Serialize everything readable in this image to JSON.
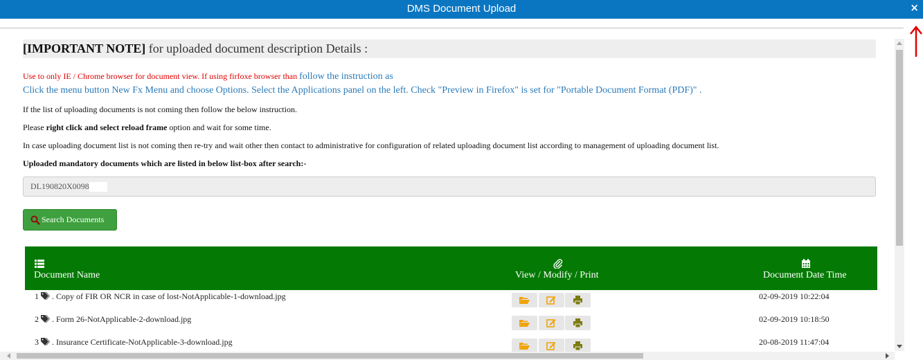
{
  "window": {
    "title": "DMS Document Upload",
    "close_label": "×"
  },
  "note": {
    "title_bold": "[IMPORTANT NOTE]",
    "title_rest": " for uploaded document description Details :",
    "browser_warning": "Use to only IE / Chrome browser for document view. If using firfoxe browser than ",
    "follow_link": "follow the instruction as",
    "firefox_instruction": "Click the menu button New Fx Menu and choose Options. Select the Applications panel on the left. Check \"Preview in Firefox\" is set for \"Portable Document Format (PDF)\" .",
    "line_list_missing": "If the list of uploading documents is not coming then follow the below instruction.",
    "reload_prefix": "Please ",
    "reload_bold": "right click and select reload frame",
    "reload_suffix": " option and wait for some time.",
    "retry_line": "In case uploading document list is not coming then re-try and wait other then contact to administrative for configuration of related uploading document list according to management of uploading document list.",
    "mandatory_label": "Uploaded mandatory documents which are listed in below list-box after search:-"
  },
  "search": {
    "value": "DL190820X0098",
    "button_label": "Search Documents"
  },
  "table": {
    "headers": {
      "name": "Document Name",
      "actions": "View / Modify / Print",
      "datetime": "Document Date Time"
    },
    "rows": [
      {
        "index": "1",
        "name": ". Copy of FIR OR NCR in case of lost-NotApplicable-1-download.jpg",
        "datetime": "02-09-2019 10:22:04"
      },
      {
        "index": "2",
        "name": ". Form 26-NotApplicable-2-download.jpg",
        "datetime": "02-09-2019 10:18:50"
      },
      {
        "index": "3",
        "name": ". Insurance Certificate-NotApplicable-3-download.jpg",
        "datetime": "20-08-2019 11:47:04"
      }
    ]
  },
  "colors": {
    "titlebar": "#0a76c2",
    "table_header": "#047a04",
    "search_button": "#3ea03e",
    "warning_red": "#e00000",
    "link_blue": "#2a7ab8",
    "action_icon": "#f0a30a",
    "arrow_annotation": "#e00000"
  },
  "icons": {
    "close": "close-icon",
    "search": "magnifier-icon",
    "list": "list-icon",
    "attach": "paperclip-icon",
    "calendar": "calendar-icon",
    "tag": "tags-icon",
    "view": "folder-open-icon",
    "modify": "edit-icon",
    "print": "print-icon",
    "annotation": "arrow-up-icon"
  }
}
